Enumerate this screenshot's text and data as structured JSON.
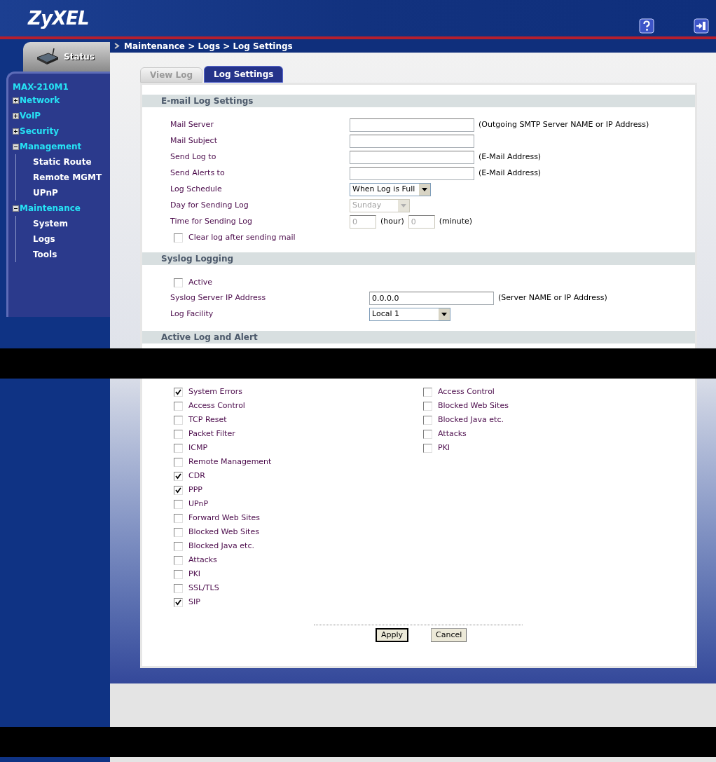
{
  "header": {
    "logo": "ZyXEL"
  },
  "sidebar": {
    "status_tab": "Status",
    "device": "MAX-210M1",
    "items": [
      {
        "label": "Network",
        "expanded": false
      },
      {
        "label": "VoIP",
        "expanded": false
      },
      {
        "label": "Security",
        "expanded": false
      },
      {
        "label": "Management",
        "expanded": true,
        "children": [
          {
            "label": "Static Route"
          },
          {
            "label": "Remote MGMT"
          },
          {
            "label": "UPnP"
          }
        ]
      },
      {
        "label": "Maintenance",
        "expanded": true,
        "children": [
          {
            "label": "System"
          },
          {
            "label": "Logs"
          },
          {
            "label": "Tools"
          }
        ]
      }
    ]
  },
  "breadcrumb": "Maintenance > Logs > Log Settings",
  "tabs": [
    {
      "label": "View Log",
      "selected": false
    },
    {
      "label": "Log Settings",
      "selected": true
    }
  ],
  "email": {
    "title": "E-mail Log Settings",
    "rows": [
      {
        "kind": "text",
        "label": "Mail Server",
        "hint": "(Outgoing SMTP Server NAME or IP Address)"
      },
      {
        "kind": "text",
        "label": "Mail Subject"
      },
      {
        "kind": "text",
        "label": "Send Log to",
        "hint": "(E-Mail Address)"
      },
      {
        "kind": "text",
        "label": "Send Alerts to",
        "hint": "(E-Mail Address)"
      },
      {
        "kind": "select",
        "label": "Log Schedule",
        "value": "When Log is Full",
        "disabled": false
      },
      {
        "kind": "select",
        "label": "Day for Sending Log",
        "value": "Sunday",
        "disabled": true
      },
      {
        "kind": "time",
        "label": "Time for Sending Log",
        "hour": "0",
        "hour_unit": "(hour)",
        "minute": "0",
        "minute_unit": "(minute)",
        "disabled": true
      },
      {
        "kind": "checkbox",
        "label": "Clear log after sending mail",
        "checked": false
      }
    ]
  },
  "syslog": {
    "title": "Syslog Logging",
    "rows": [
      {
        "kind": "checkbox",
        "label": "Active",
        "checked": false
      },
      {
        "kind": "text",
        "label": "Syslog Server IP Address",
        "value": "0.0.0.0",
        "hint": "(Server NAME or IP Address)"
      },
      {
        "kind": "select",
        "label": "Log Facility",
        "value": "Local 1",
        "disabled": false
      }
    ]
  },
  "active_log": {
    "title": "Active Log and Alert",
    "log": [
      {
        "label": "System Errors",
        "checked": true
      },
      {
        "label": "Access Control",
        "checked": false
      },
      {
        "label": "TCP Reset",
        "checked": false
      },
      {
        "label": "Packet Filter",
        "checked": false
      },
      {
        "label": "ICMP",
        "checked": false
      },
      {
        "label": "Remote Management",
        "checked": false
      },
      {
        "label": "CDR",
        "checked": true
      },
      {
        "label": "PPP",
        "checked": true
      },
      {
        "label": "UPnP",
        "checked": false
      },
      {
        "label": "Forward Web Sites",
        "checked": false
      },
      {
        "label": "Blocked Web Sites",
        "checked": false
      },
      {
        "label": "Blocked Java etc.",
        "checked": false
      },
      {
        "label": "Attacks",
        "checked": false
      },
      {
        "label": "PKI",
        "checked": false
      },
      {
        "label": "SSL/TLS",
        "checked": false
      },
      {
        "label": "SIP",
        "checked": true
      }
    ],
    "alert": [
      {
        "label": "Access Control",
        "checked": false
      },
      {
        "label": "Blocked Web Sites",
        "checked": false
      },
      {
        "label": "Blocked Java etc.",
        "checked": false
      },
      {
        "label": "Attacks",
        "checked": false
      },
      {
        "label": "PKI",
        "checked": false
      }
    ]
  },
  "buttons": [
    {
      "label": "Apply",
      "selected": true
    },
    {
      "label": "Cancel",
      "selected": false
    }
  ]
}
